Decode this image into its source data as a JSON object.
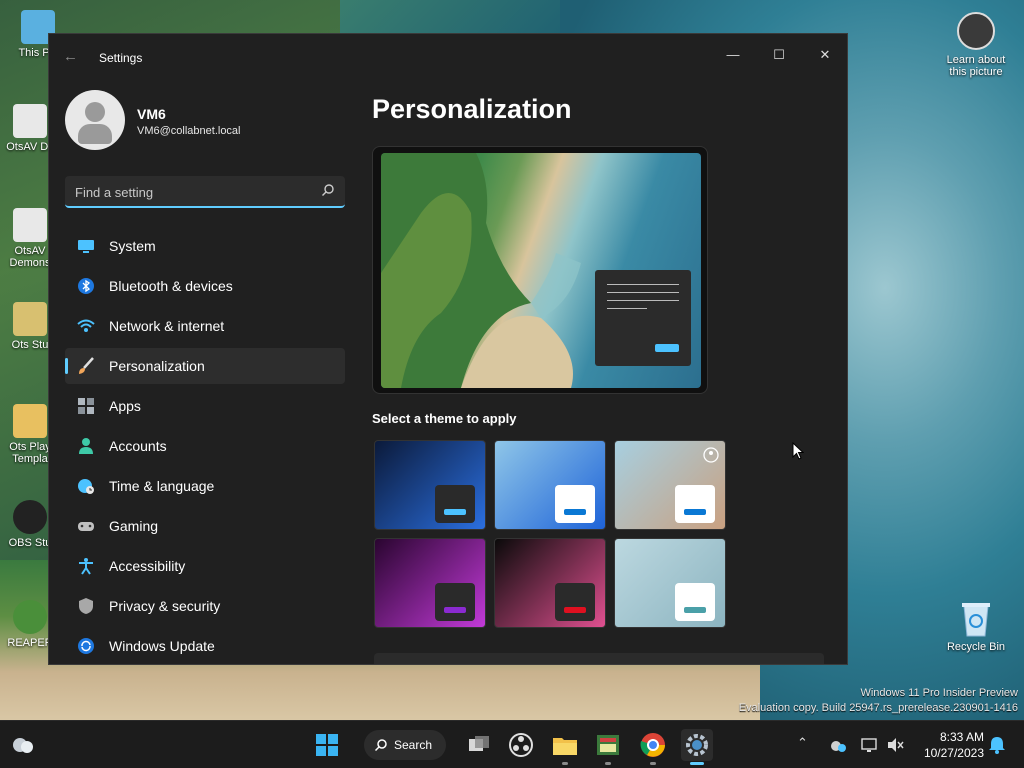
{
  "desktop": {
    "icons": [
      {
        "label": "This PC"
      },
      {
        "label": "OtsAV DJ"
      },
      {
        "label": "OtsAV Demons"
      },
      {
        "label": "Ots Stu"
      },
      {
        "label": "Ots Play Templa"
      },
      {
        "label": "OBS Stu"
      },
      {
        "label": "REAPER"
      }
    ],
    "learn_label": "Learn about this picture",
    "recycle_label": "Recycle Bin",
    "watermark_line1": "Windows 11 Pro Insider Preview",
    "watermark_line2": "Evaluation copy. Build 25947.rs_prerelease.230901-1416"
  },
  "window": {
    "title": "Settings",
    "controls": {
      "minimize": "—",
      "maximize": "☐",
      "close": "✕"
    }
  },
  "profile": {
    "name": "VM6",
    "email": "VM6@collabnet.local"
  },
  "search": {
    "placeholder": "Find a setting"
  },
  "nav": {
    "items": [
      {
        "label": "System",
        "icon": "monitor-icon",
        "color": "#4cc2ff"
      },
      {
        "label": "Bluetooth & devices",
        "icon": "bluetooth-icon",
        "color": "#1e90ff"
      },
      {
        "label": "Network & internet",
        "icon": "wifi-icon",
        "color": "#4cc2ff"
      },
      {
        "label": "Personalization",
        "icon": "brush-icon",
        "color": "#f2a65a",
        "active": true
      },
      {
        "label": "Apps",
        "icon": "apps-icon",
        "color": "#b0b8c0"
      },
      {
        "label": "Accounts",
        "icon": "person-icon",
        "color": "#3ec9a7"
      },
      {
        "label": "Time & language",
        "icon": "globe-clock-icon",
        "color": "#4cc2ff"
      },
      {
        "label": "Gaming",
        "icon": "gamepad-icon",
        "color": "#c0c0c0"
      },
      {
        "label": "Accessibility",
        "icon": "accessibility-icon",
        "color": "#4cc2ff"
      },
      {
        "label": "Privacy & security",
        "icon": "shield-icon",
        "color": "#a8a8a8"
      },
      {
        "label": "Windows Update",
        "icon": "update-icon",
        "color": "#4cc2ff"
      }
    ]
  },
  "main": {
    "title": "Personalization",
    "themes_label": "Select a theme to apply",
    "themes": [
      {
        "name": "windows-light-bloom",
        "bg1": "#0b1a3a",
        "bg2": "#2b6fe0",
        "chip": "#2a2a2a",
        "bar": "#4cc2ff"
      },
      {
        "name": "windows-dark-bloom",
        "bg1": "#8fc6e8",
        "bg2": "#1e63d8",
        "chip": "#ffffff",
        "bar": "#0a78d4"
      },
      {
        "name": "spotlight",
        "bg1": "#a7cfe0",
        "bg2": "#c9a080",
        "chip": "#ffffff",
        "bar": "#0a78d4"
      },
      {
        "name": "glow",
        "bg1": "#2a0530",
        "bg2": "#c23ad8",
        "chip": "#2a2a2a",
        "bar": "#8a2ad0"
      },
      {
        "name": "captured-motion",
        "bg1": "#0a0a0a",
        "bg2": "#e05090",
        "chip": "#2a2a2a",
        "bar": "#e01020"
      },
      {
        "name": "flow",
        "bg1": "#bcd8e0",
        "bg2": "#8cb4c0",
        "chip": "#ffffff",
        "bar": "#4aa0a8"
      }
    ]
  },
  "taskbar": {
    "search_label": "Search",
    "time": "8:33 AM",
    "date": "10/27/2023"
  }
}
